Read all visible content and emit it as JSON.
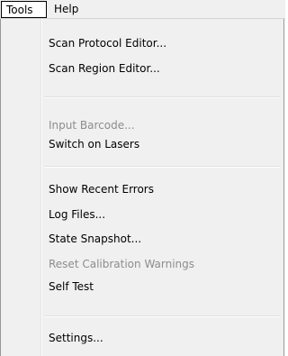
{
  "menubar": {
    "items": [
      {
        "label": "Tools"
      },
      {
        "label": "Help"
      }
    ]
  },
  "tools_menu": {
    "items": [
      {
        "label": "Scan Protocol Editor...",
        "enabled": true
      },
      {
        "label": "Scan Region Editor...",
        "enabled": true
      },
      {
        "label": "Input Barcode...",
        "enabled": false
      },
      {
        "label": "Switch on Lasers",
        "enabled": true
      },
      {
        "label": "Show Recent Errors",
        "enabled": true
      },
      {
        "label": "Log Files...",
        "enabled": true
      },
      {
        "label": "State Snapshot...",
        "enabled": true
      },
      {
        "label": "Reset Calibration Warnings",
        "enabled": false
      },
      {
        "label": "Self Test",
        "enabled": true
      },
      {
        "label": "Settings...",
        "enabled": true
      }
    ]
  },
  "colors": {
    "menu_background": "#f0f0f0",
    "disabled_text": "#8d8d8d",
    "border": "#979797"
  }
}
